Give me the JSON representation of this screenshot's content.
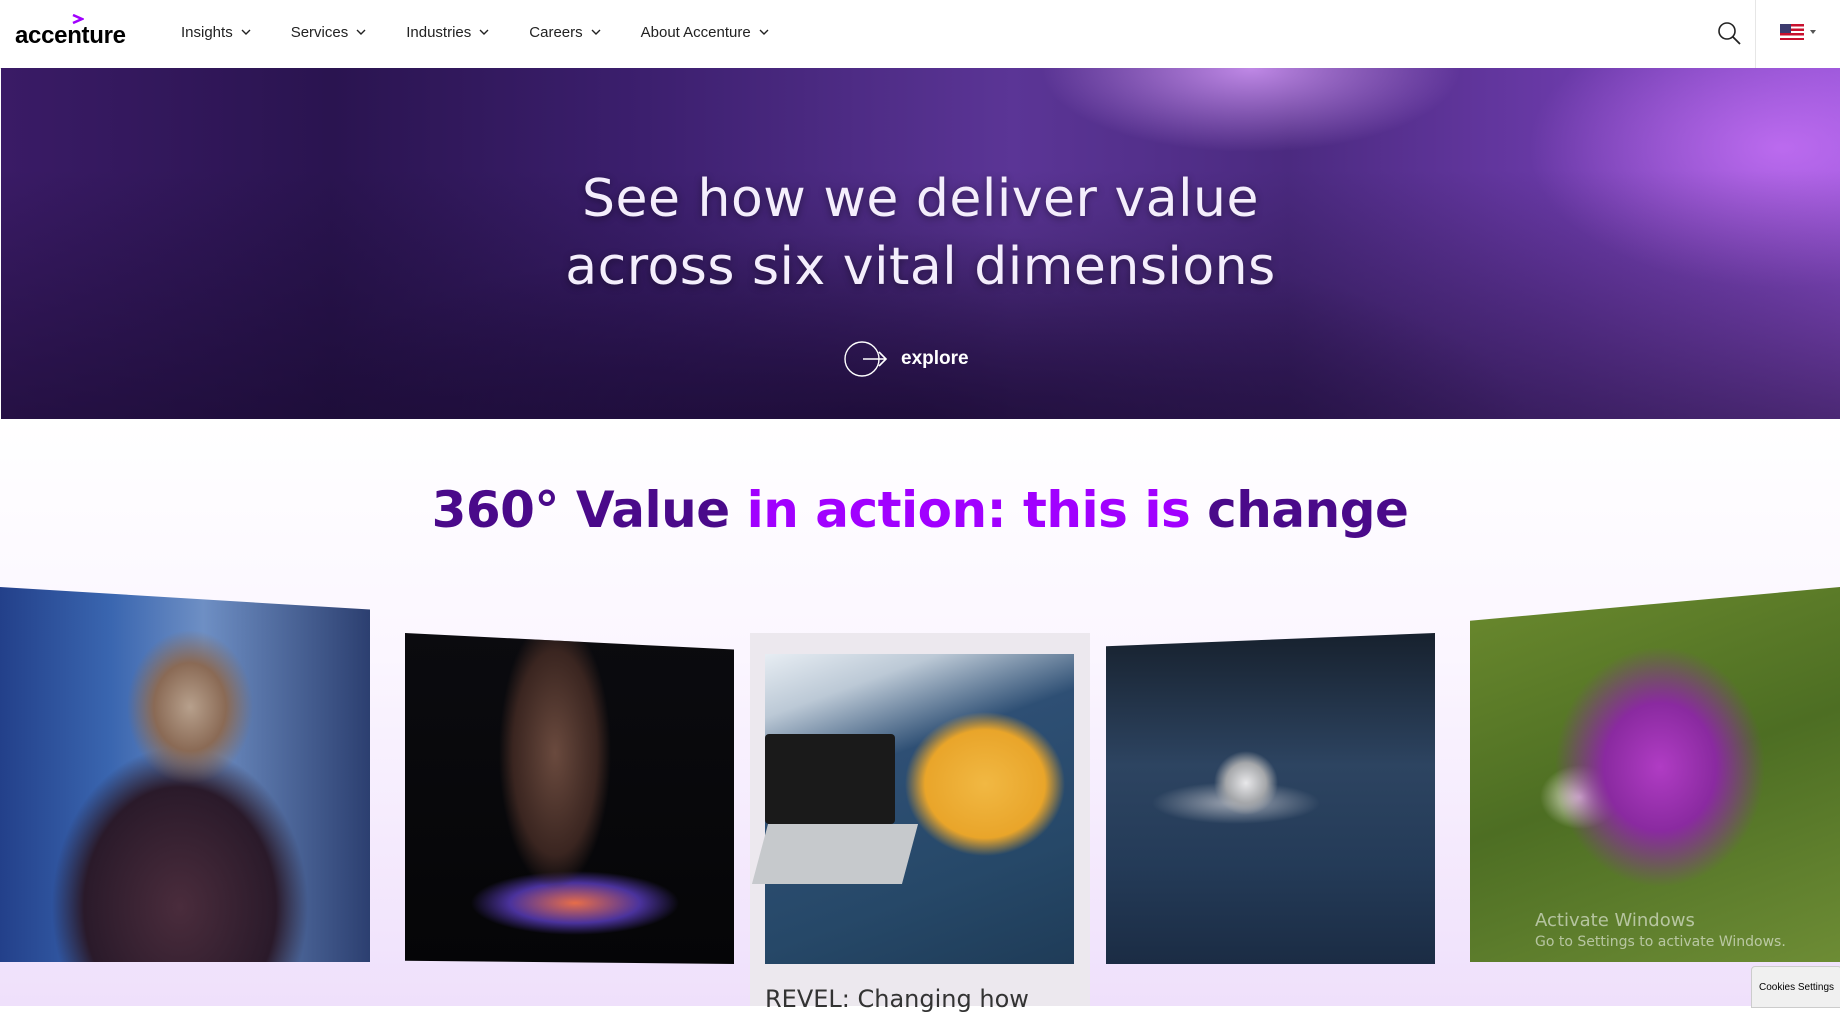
{
  "header": {
    "logo_text": "accenture",
    "nav": [
      {
        "label": "Insights"
      },
      {
        "label": "Services"
      },
      {
        "label": "Industries"
      },
      {
        "label": "Careers"
      },
      {
        "label": "About Accenture"
      }
    ],
    "search_icon": "search-icon",
    "locale_icon": "us-flag-icon"
  },
  "hero": {
    "title_line1": "See how we deliver value",
    "title_line2": "across six vital dimensions",
    "cta_label": "explore",
    "cta_icon": "arrow-circle-icon"
  },
  "section": {
    "title_part1": "360° Value",
    "title_part2": "in action: this is",
    "title_part3": "change",
    "featured_card_caption": "REVEL: Changing how",
    "accent_color": "#a100ff",
    "dark_color": "#4a0a8a"
  },
  "os_overlay": {
    "watermark_line1": "Activate Windows",
    "watermark_line2": "Go to Settings to activate Windows."
  },
  "cookies_button": "Cookies Settings"
}
